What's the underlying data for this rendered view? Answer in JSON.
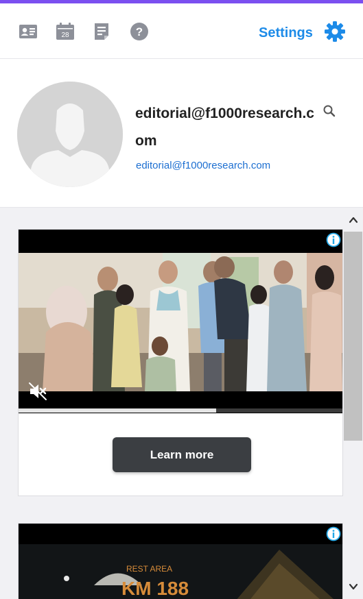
{
  "toolbar": {
    "icons": [
      "contact-card-icon",
      "calendar-icon",
      "notes-icon",
      "help-icon"
    ],
    "calendar_day": "28",
    "settings_label": "Settings"
  },
  "profile": {
    "name": "editorial@f1000research.com",
    "email": "editorial@f1000research.com"
  },
  "ads": [
    {
      "cta_label": "Learn more",
      "video_progress": 0.61
    },
    {
      "sign_top": "REST AREA",
      "sign_main": "KM 188"
    }
  ],
  "colors": {
    "accent_bar": "#7b4ff0",
    "settings_blue": "#1d8be8",
    "link_blue": "#1d6fd1",
    "cta_bg": "#3b3e42"
  }
}
